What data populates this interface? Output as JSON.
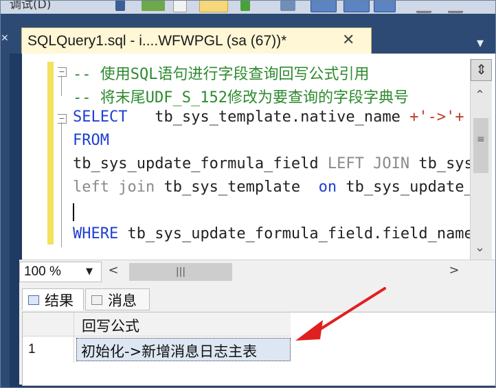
{
  "menu": {
    "debug_label": "调试(D)"
  },
  "document_tab": {
    "title": "SQLQuery1.sql - i....WFWPGL (sa (67))*",
    "close": "✕"
  },
  "code_lines": [
    {
      "text": "-- 使用SQL语句进行字段查询回写公式引用"
    },
    {
      "text": "-- 将末尾UDF_S_152修改为要查询的字段字典号"
    },
    {
      "kw": "SELECT",
      "rest": "   tb_sys_template.native_name ",
      "op": "+'->'+"
    },
    {
      "kw": "FROM"
    },
    {
      "text": "tb_sys_update_formula_field ",
      "gry": "LEFT JOIN ",
      "rest": "tb_sys"
    },
    {
      "gry": "left join ",
      "text": "tb_sys_template  ",
      "kw": "on ",
      "rest": "tb_sys_update_"
    },
    {
      "text": ""
    },
    {
      "kw": "WHERE ",
      "rest": "tb_sys_update_formula_field.field_name"
    }
  ],
  "zoom": {
    "value": "100 %"
  },
  "results_tabs": [
    {
      "label": "结果"
    },
    {
      "label": "消息"
    }
  ],
  "grid": {
    "columns": [
      "回写公式"
    ],
    "rows": [
      {
        "row_number": "1",
        "value": "初始化->新增消息日志主表"
      }
    ]
  },
  "colors": {
    "annotation_arrow": "#e02020",
    "comment": "#2d8a2d",
    "keyword": "#1f3fd0",
    "editor_margin": "#f5e15c"
  }
}
